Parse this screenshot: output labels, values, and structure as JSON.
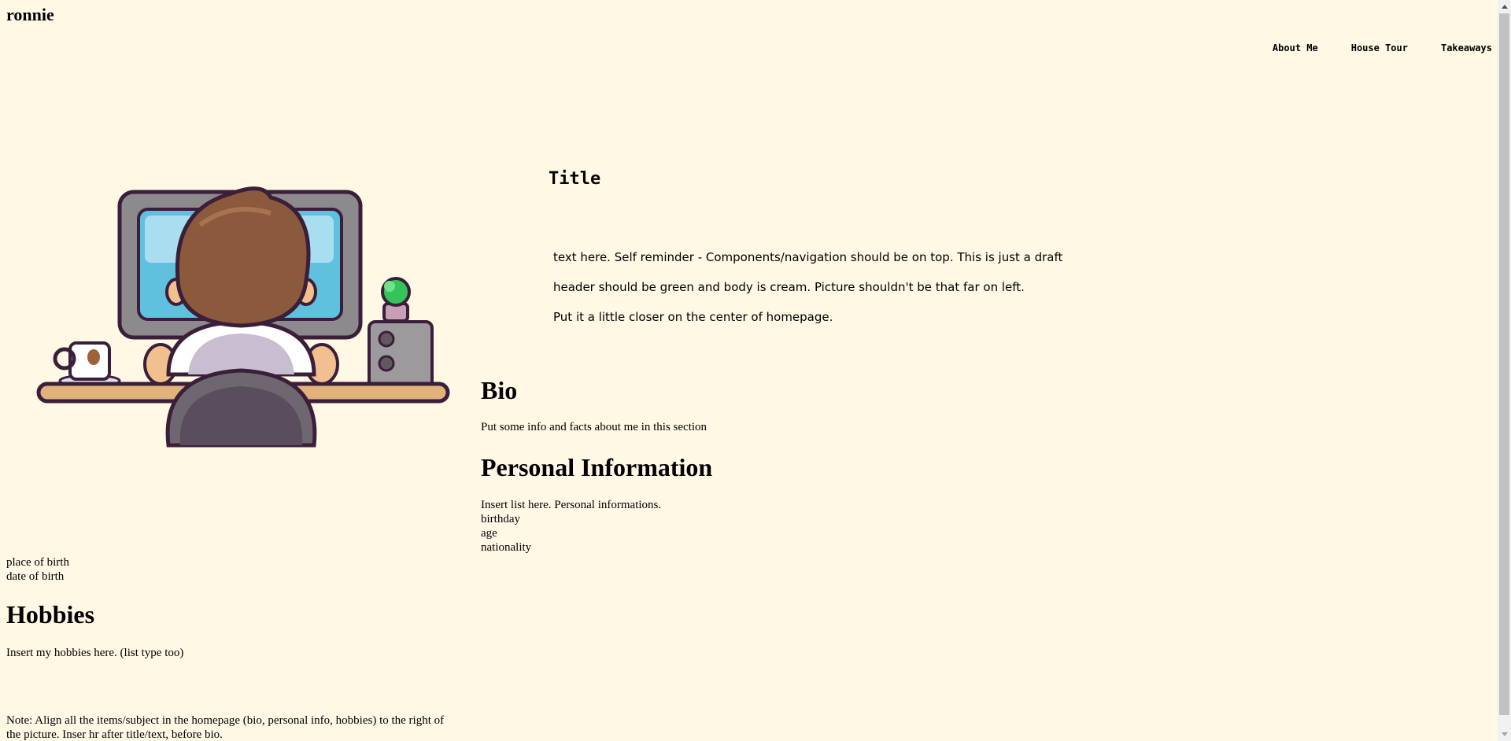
{
  "header": {
    "brand": "ronnie",
    "nav": [
      "About Me",
      "House Tour",
      "Takeaways"
    ]
  },
  "hero": {
    "title": "Title",
    "lines": [
      "text here. Self reminder - Components/navigation should be on top. This is just a draft",
      "header should be green and body is cream. Picture shouldn't be that far on left.",
      "Put it a little closer on the center of homepage."
    ],
    "illustration": "person-at-computer-illustration"
  },
  "bio": {
    "heading": "Bio",
    "text": "Put some info and facts about me in this section"
  },
  "personal_info": {
    "heading": "Personal Information",
    "items": [
      "Insert list here. Personal informations.",
      "birthday",
      "age",
      "nationality",
      "place of birth",
      "date of birth"
    ]
  },
  "hobbies": {
    "heading": "Hobbies",
    "text": "Insert my hobbies here. (list type too)"
  },
  "note": "Note: Align all the items/subject in the homepage (bio, personal info, hobbies) to the right of the picture. Inser hr after title/text, before bio.",
  "colors": {
    "background": "#fff8e5",
    "text": "#000000"
  }
}
